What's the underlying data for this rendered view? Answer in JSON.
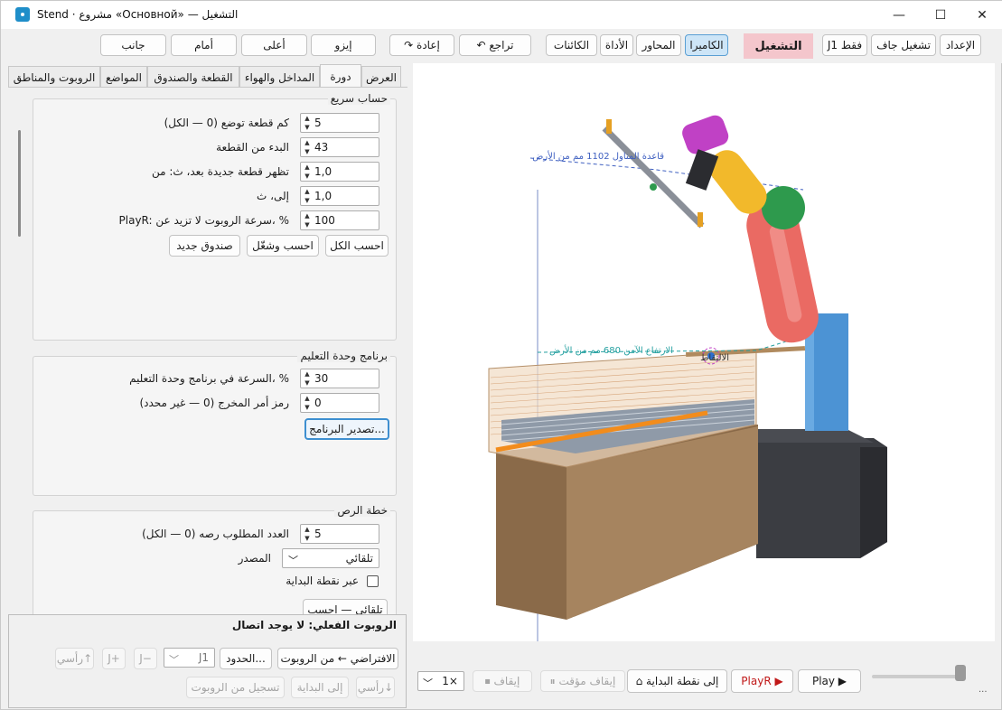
{
  "window": {
    "title": "Stend · مشروع «Основной» — التشغيل",
    "minimize": "—",
    "maximize": "☐",
    "close": "✕"
  },
  "toolbar": {
    "side": "جانب",
    "front": "أمام",
    "top": "أعلى",
    "iso": "إيزو",
    "redo": "↷ إعادة",
    "undo": "↶ تراجع",
    "objects": "الكائنات",
    "tool": "الأداة",
    "axes": "المحاور",
    "camera": "الكاميرا",
    "run": "التشغيل",
    "j1_only": "J1 فقط",
    "dry_run": "تشغيل جاف",
    "setup": "الإعداد"
  },
  "tabs": [
    "العرض",
    "دورة",
    "المداخل والهواء",
    "القطعة والصندوق",
    "المواضع",
    "الروبوت والمناطق"
  ],
  "quick_calc": {
    "title": "حساب سريع",
    "rows": [
      {
        "label": "كم قطعة توضع (0 — الكل)",
        "value": "5"
      },
      {
        "label": "البدء من القطعة",
        "value": "43"
      },
      {
        "label": "تظهر قطعة جديدة بعد، ث: من",
        "value": "1,0"
      },
      {
        "label": "إلى، ث",
        "value": "1,0"
      },
      {
        "label": "PlayR: سرعة الروبوت لا تزيد عن، %",
        "value": "100"
      }
    ],
    "btn_calc_all": "احسب الكل",
    "btn_calc_run": "احسب وشغّل",
    "btn_new_box": "صندوق جديد"
  },
  "teach": {
    "title": "برنامج وحدة التعليم",
    "rows": [
      {
        "label": "السرعة في برنامج وحدة التعليم، %",
        "value": "30"
      },
      {
        "label": "رمز أمر المخرج (0 — غير محدد)",
        "value": "0"
      }
    ],
    "btn_export": "تصدير البرنامج..."
  },
  "stacking": {
    "title": "خطة الرص",
    "rows": [
      {
        "label": "العدد المطلوب رصه (0 — الكل)",
        "value": "5"
      }
    ],
    "source_label": "المصدر",
    "source_value": "تلقائي",
    "via_start": "عبر نقطة البداية",
    "cut_button": "تلقائي — احسب"
  },
  "robot_panel": {
    "title": "الروبوت الفعلي: لا يوجد اتصال",
    "default_btn": "الافتراضي ← من الروبوت",
    "limits_btn": "الحدود...",
    "joint": "J1",
    "minus": "J−",
    "plus": "J+",
    "vert_up": "رأسي↑",
    "vert_down": "رأسي↓",
    "to_start": "إلى البداية",
    "record": "تسجيل من الروبوت"
  },
  "viewport": {
    "label_base": "قاعدة المناول 1102 مم من الأرض",
    "label_safe": "الارتفاع الآمن 680 مم من الأرض",
    "label_pick": "الالتقاط"
  },
  "playback": {
    "speed": "1×",
    "stop": "⏹ إيقاف",
    "pause": "⏸ إيقاف مؤقت",
    "to_start": "⌂ إلى نقطة البداية",
    "playr": "PlayR ▶",
    "play": "Play ▶",
    "corner": "..."
  },
  "colors": {
    "accent": "#3e8fd0",
    "run_bg": "#f4c6cc",
    "camera_bg": "#cde5f7",
    "robot_red": "#ea6a63",
    "robot_yellow": "#f2b92b",
    "robot_green": "#2e9a4d",
    "robot_magenta": "#c041c5",
    "pedestal_blue": "#4c93d4",
    "box_tan": "#a6845f",
    "conveyor_orange": "#f28c1c"
  }
}
